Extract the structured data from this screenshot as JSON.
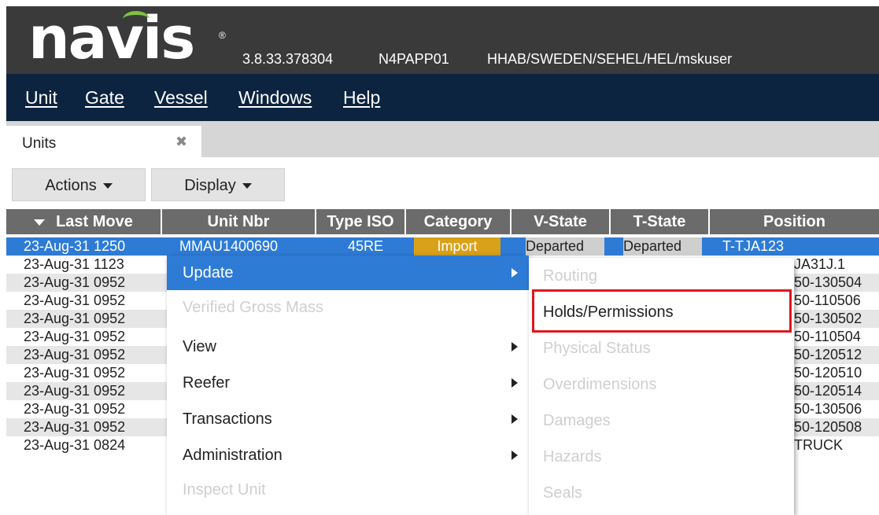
{
  "header": {
    "logo": "navis",
    "version": "3.8.33.378304",
    "server": "N4PAPP01",
    "scope": "HHAB/SWEDEN/SEHEL/HEL/mskuser"
  },
  "menu": [
    "Unit",
    "Gate",
    "Vessel",
    "Windows",
    "Help"
  ],
  "tab": {
    "label": "Units",
    "close": "✖"
  },
  "toolbar": {
    "actions": "Actions",
    "display": "Display"
  },
  "columns": [
    "Last Move",
    "Unit Nbr",
    "Type ISO",
    "Category",
    "V-State",
    "T-State",
    "Position"
  ],
  "rows": [
    {
      "last_move": "23-Aug-31 1250",
      "unit_nbr": "MMAU1400690",
      "type_iso": "45RE",
      "category": "Import",
      "v_state": "Departed",
      "t_state": "Departed",
      "position": "T-TJA123"
    },
    {
      "last_move": "23-Aug-31 1123",
      "position": "JA31J.1"
    },
    {
      "last_move": "23-Aug-31 0952",
      "position": "50-130504"
    },
    {
      "last_move": "23-Aug-31 0952",
      "position": "50-110506"
    },
    {
      "last_move": "23-Aug-31 0952",
      "position": "50-130502"
    },
    {
      "last_move": "23-Aug-31 0952",
      "position": "50-110504"
    },
    {
      "last_move": "23-Aug-31 0952",
      "position": "50-120512"
    },
    {
      "last_move": "23-Aug-31 0952",
      "position": "50-120510"
    },
    {
      "last_move": "23-Aug-31 0952",
      "position": "50-120514"
    },
    {
      "last_move": "23-Aug-31 0952",
      "position": "50-130506"
    },
    {
      "last_move": "23-Aug-31 0952",
      "position": "50-120508"
    },
    {
      "last_move": "23-Aug-31 0824",
      "position": "TRUCK"
    }
  ],
  "context_menu": [
    {
      "label": "Update",
      "submenu": true,
      "state": "active"
    },
    {
      "label": "Verified Gross Mass",
      "submenu": false,
      "state": "disabled"
    },
    {
      "label": "View",
      "submenu": true,
      "state": "enabled"
    },
    {
      "label": "Reefer",
      "submenu": true,
      "state": "enabled"
    },
    {
      "label": "Transactions",
      "submenu": true,
      "state": "enabled"
    },
    {
      "label": "Administration",
      "submenu": true,
      "state": "enabled"
    },
    {
      "label": "Inspect Unit",
      "submenu": false,
      "state": "disabled"
    }
  ],
  "submenu": [
    {
      "label": "Routing",
      "state": "disabled"
    },
    {
      "label": "Holds/Permissions",
      "state": "enabled"
    },
    {
      "label": "Physical Status",
      "state": "disabled"
    },
    {
      "label": "Overdimensions",
      "state": "disabled"
    },
    {
      "label": "Damages",
      "state": "disabled"
    },
    {
      "label": "Hazards",
      "state": "disabled"
    },
    {
      "label": "Seals",
      "state": "disabled"
    }
  ],
  "colors": {
    "selection": "#2e7bd6",
    "menubar": "#0c2440",
    "header": "#3a3a3a",
    "highlight_box": "#e0161b",
    "category_import": "#d9a11a"
  }
}
